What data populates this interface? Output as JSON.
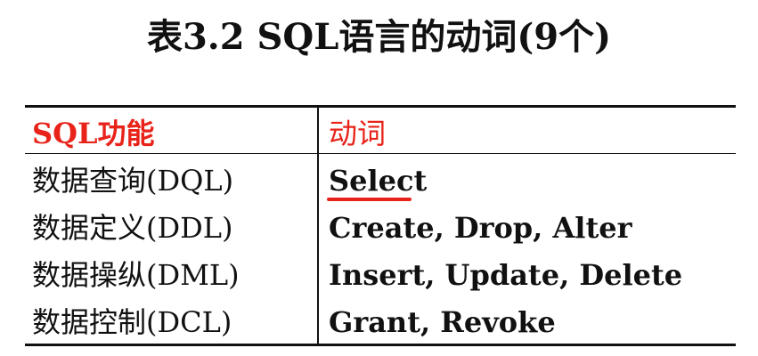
{
  "title": "表3.2 SQL语言的动词(9个)",
  "table": {
    "headers": [
      "SQL功能",
      "动词"
    ],
    "rows": [
      {
        "function": "数据查询(DQL)",
        "verbs": "Select"
      },
      {
        "function": "数据定义(DDL)",
        "verbs": "Create, Drop, Alter"
      },
      {
        "function": "数据操纵(DML)",
        "verbs": "Insert, Update, Delete"
      },
      {
        "function": "数据控制(DCL)",
        "verbs": "Grant, Revoke"
      }
    ]
  },
  "colors": {
    "header_text": "#e8231a",
    "underline": "#e8231a",
    "body_text": "#111111",
    "rule": "#111111"
  }
}
